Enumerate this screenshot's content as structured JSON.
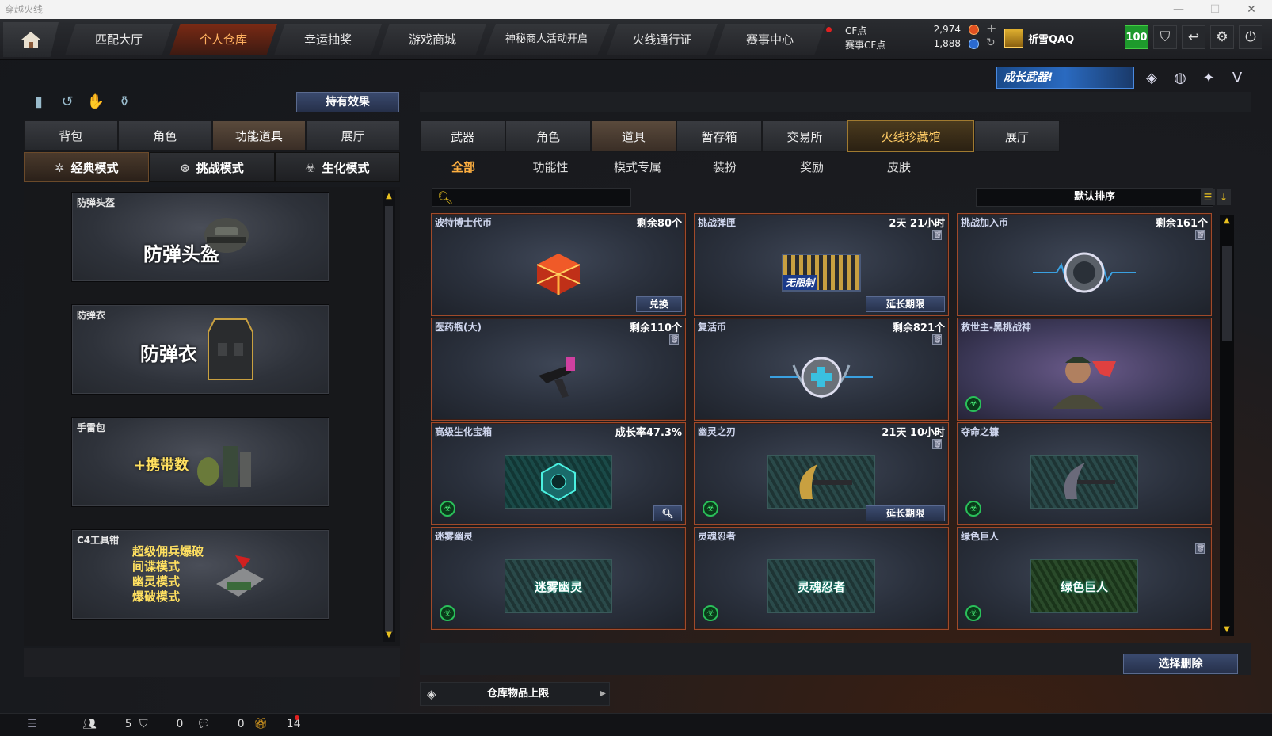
{
  "window": {
    "title": "穿越火线"
  },
  "nav": {
    "tabs": [
      {
        "label": "匹配大厅"
      },
      {
        "label": "个人仓库"
      },
      {
        "label": "幸运抽奖"
      },
      {
        "label": "游戏商城"
      },
      {
        "label": "神秘商人活动开启"
      },
      {
        "label": "火线通行证"
      },
      {
        "label": "赛事中心"
      }
    ]
  },
  "currency": {
    "cf_label": "CF点",
    "cf_value": "2,974",
    "match_label": "赛事CF点",
    "match_value": "1,888"
  },
  "user": {
    "name": "祈雪QAQ",
    "level": "100"
  },
  "banner": {
    "label": "成长武器!"
  },
  "left": {
    "effect_button": "持有效果",
    "tabs": [
      {
        "label": "背包"
      },
      {
        "label": "角色"
      },
      {
        "label": "功能道具"
      },
      {
        "label": "展厅"
      }
    ],
    "modes": [
      {
        "label": "经典模式"
      },
      {
        "label": "挑战模式"
      },
      {
        "label": "生化模式"
      }
    ],
    "cards": [
      {
        "title": "防弹头盔",
        "big": "防弹头盔"
      },
      {
        "title": "防弹衣",
        "big": "防弹衣"
      },
      {
        "title": "手雷包",
        "big": "+携带数"
      },
      {
        "title": "C4工具钳",
        "lines": [
          "超级佣兵爆破",
          "间谍模式",
          "幽灵模式",
          "爆破模式"
        ]
      }
    ]
  },
  "right": {
    "tabs": [
      {
        "label": "武器"
      },
      {
        "label": "角色"
      },
      {
        "label": "道具"
      },
      {
        "label": "暂存箱"
      },
      {
        "label": "交易所"
      },
      {
        "label": "火线珍藏馆"
      },
      {
        "label": "展厅"
      }
    ],
    "subtabs": [
      {
        "label": "全部"
      },
      {
        "label": "功能性"
      },
      {
        "label": "模式专属"
      },
      {
        "label": "装扮"
      },
      {
        "label": "奖励"
      },
      {
        "label": "皮肤"
      }
    ],
    "sort_label": "默认排序",
    "search_placeholder": "",
    "items": [
      {
        "name": "波特博士代币",
        "info": "剩余80个",
        "action": "兑换"
      },
      {
        "name": "挑战弹匣",
        "info": "2天 21小时",
        "action": "延长期限",
        "pic_text": "无限制"
      },
      {
        "name": "挑战加入币",
        "info": "剩余161个"
      },
      {
        "name": "医药瓶(大)",
        "info": "剩余110个"
      },
      {
        "name": "复活币",
        "info": "剩余821个"
      },
      {
        "name": "救世主-黑桃战神",
        "info": ""
      },
      {
        "name": "高级生化宝箱",
        "info": "成长率47.3%"
      },
      {
        "name": "幽灵之刃",
        "info": "21天 10小时",
        "action": "延长期限"
      },
      {
        "name": "夺命之镰",
        "info": ""
      },
      {
        "name": "迷雾幽灵",
        "info": "",
        "pic_text": "迷雾幽灵"
      },
      {
        "name": "灵魂忍者",
        "info": "",
        "pic_text": "灵魂忍者"
      },
      {
        "name": "绿色巨人",
        "info": "",
        "pic_text": "绿色巨人"
      }
    ],
    "delete_button": "选择删除",
    "storage_label": "仓库物品上限"
  },
  "status": {
    "count1": "5",
    "count2": "0",
    "count3": "0",
    "count4": "14"
  },
  "colors": {
    "accent": "#ffb040",
    "border_item": "#a04a2a",
    "level_green": "#1e9a2c"
  }
}
